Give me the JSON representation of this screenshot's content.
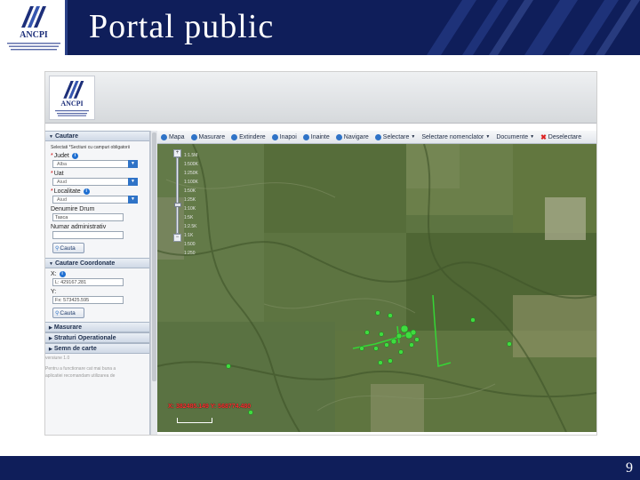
{
  "slide": {
    "title": "Portal public",
    "page_number": "9",
    "header_bg": "#0f1e5a"
  },
  "logo": {
    "name": "ANCPI",
    "icon": "ancpi-logo-icon"
  },
  "left_panel": {
    "search_header": "Cautare",
    "hint": "Selectati *Sectiuni cu campuri obligatorii",
    "judet_label": "Judet",
    "judet_value": "Alba",
    "uat_label": "Uat",
    "uat_value": "Aiud",
    "localitate_label": "Localitate",
    "localitate_value": "Aiud",
    "drum_label": "Denumire Drum",
    "drum_value": "Tasca",
    "nr_admin_label": "Numar administrativ",
    "nr_admin_value": "",
    "search_button": "Cauta",
    "coord_header": "Cautare Coordonate",
    "x_label": "X:",
    "x_value": "L: 429167.281",
    "y_label": "Y:",
    "y_value": "Fx: 573425.595",
    "coord_button": "Cauta",
    "masurare": "Masurare",
    "straturi": "Straturi Operationale",
    "semn": "Semn de carte",
    "version": "versiune 1.0",
    "footer_line1": "Pentru a functionare cat mai buna a",
    "footer_line2": "aplicatiei recomandam utilizarea de"
  },
  "toolbar": {
    "items": [
      {
        "label": "Mapa",
        "icon": "map-icon"
      },
      {
        "label": "Masurare",
        "icon": "measure-icon"
      },
      {
        "label": "Extindere",
        "icon": "extent-icon"
      },
      {
        "label": "Inapoi",
        "icon": "back-icon"
      },
      {
        "label": "Inainte",
        "icon": "forward-icon"
      },
      {
        "label": "Navigare",
        "icon": "navigate-icon"
      },
      {
        "label": "Selectare",
        "icon": "select-icon",
        "dropdown": true
      },
      {
        "label": "Selectare nomenclator",
        "icon": "",
        "dropdown": true
      },
      {
        "label": "Documente",
        "icon": "",
        "dropdown": true
      },
      {
        "label": "Deselectare",
        "icon": "clear-selection-icon"
      }
    ]
  },
  "map": {
    "zoom_levels": [
      "1:1.5M",
      "1:500K",
      "1:250K",
      "1:100K",
      "1:50K",
      "1:25K",
      "1:10K",
      "1:5K",
      "1:2.5K",
      "1:1K",
      "1:500",
      "1:250"
    ],
    "coordinate_readout": "X: 382485.149 Y: 568774.480",
    "marker_color": "#3fdc3f",
    "road_color": "#35d635"
  }
}
